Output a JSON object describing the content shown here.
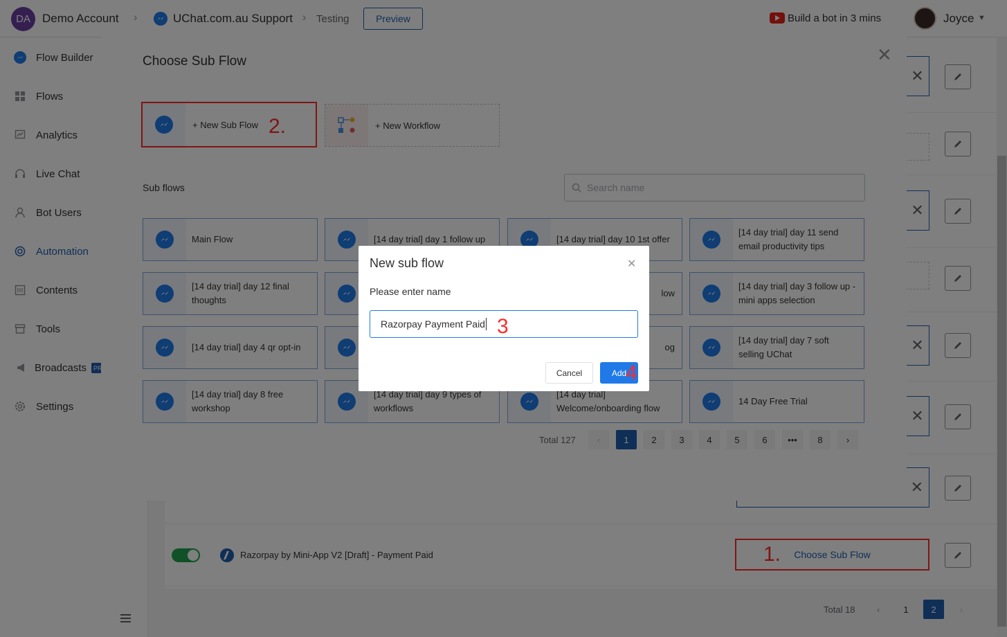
{
  "topbar": {
    "account_initials": "DA",
    "account_name": "Demo Account",
    "workspace": "UChat.com.au Support",
    "breadcrumb_current": "Testing",
    "preview_label": "Preview",
    "promo_text": "Build a bot in 3 mins",
    "user_name": "Joyce"
  },
  "sidebar": {
    "items": [
      {
        "label": "Flow Builder",
        "icon": "messenger-icon"
      },
      {
        "label": "Flows",
        "icon": "grid-icon"
      },
      {
        "label": "Analytics",
        "icon": "chart-icon"
      },
      {
        "label": "Live Chat",
        "icon": "headset-icon"
      },
      {
        "label": "Bot Users",
        "icon": "user-icon"
      },
      {
        "label": "Automation",
        "icon": "automation-icon"
      },
      {
        "label": "Contents",
        "icon": "contents-icon"
      },
      {
        "label": "Tools",
        "icon": "tools-icon"
      },
      {
        "label": "Broadcasts",
        "icon": "megaphone-icon"
      },
      {
        "label": "Settings",
        "icon": "gear-icon"
      }
    ],
    "broadcasts_badge": "PR",
    "active": "Automation"
  },
  "background_list": {
    "row_title": "Razorpay by Mini-App V2 [Draft] - Payment Paid",
    "choose_label": "Choose Sub Flow",
    "step1": "1.",
    "pagination": {
      "total": "Total 18",
      "pages": [
        "1",
        "2"
      ],
      "current": "2"
    },
    "toggle_on": true
  },
  "dialog": {
    "title": "Choose Sub Flow",
    "new_sub_flow": "+ New Sub Flow",
    "step2": "2.",
    "new_workflow": "+ New Workflow",
    "subflows_heading": "Sub flows",
    "search_placeholder": "Search name",
    "cards": [
      "Main Flow",
      "[14 day trial] day 1 follow up",
      "[14 day trial] day 10 1st offer",
      "[14 day trial] day 11 send email productivity tips",
      "[14 day trial] day 12 final thoughts",
      "",
      "low",
      "[14 day trial] day 3 follow up -mini apps selection",
      "[14 day trial] day 4 qr opt-in",
      "",
      "og",
      "[14 day trial] day 7 soft selling UChat",
      "[14 day trial] day 8 free workshop",
      "[14 day trial] day 9 types of workflows",
      "[14 day trial] Welcome/onboarding flow",
      "14 Day Free Trial"
    ],
    "pagination": {
      "total": "Total 127",
      "pages": [
        "1",
        "2",
        "3",
        "4",
        "5",
        "6",
        "•••",
        "8"
      ],
      "current": "1"
    }
  },
  "modal": {
    "title": "New sub flow",
    "prompt": "Please enter name",
    "value": "Razorpay Payment Paid",
    "step3": "3",
    "cancel_label": "Cancel",
    "add_label": "Add",
    "step4": "4"
  },
  "colors": {
    "accent": "#1f5fad",
    "primary": "#1f7ae8",
    "highlight": "#ff2a2a",
    "toggle": "#20a350"
  }
}
